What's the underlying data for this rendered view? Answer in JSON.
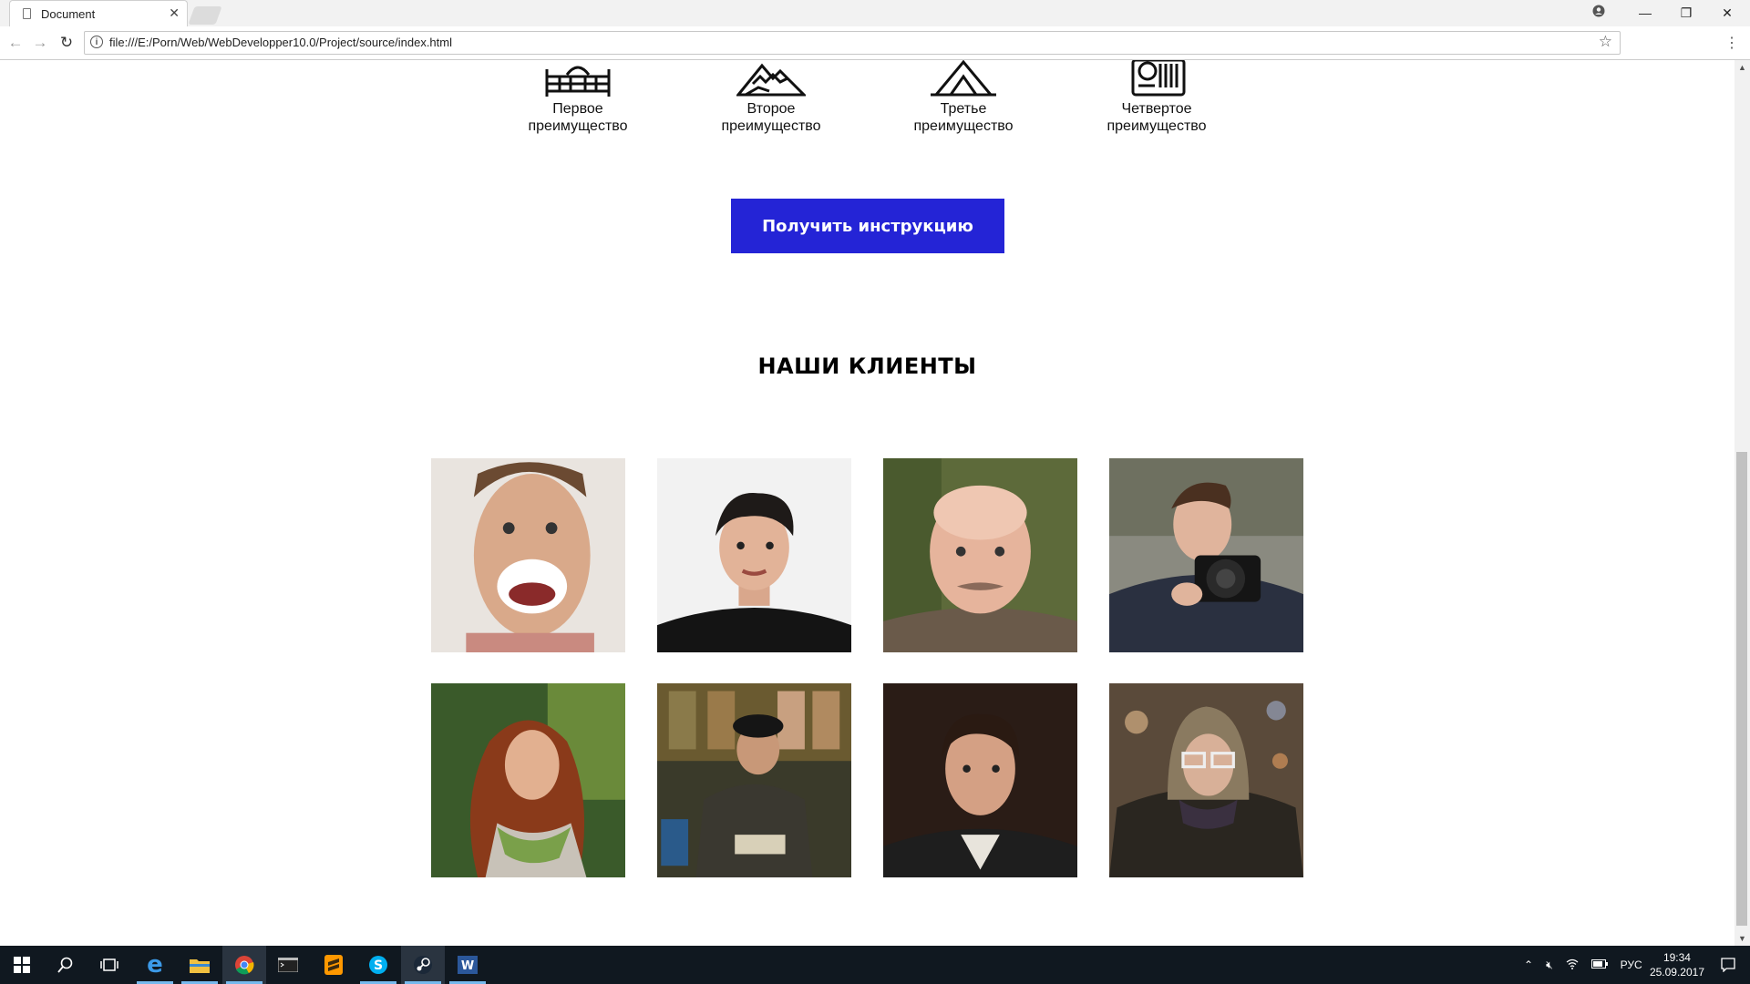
{
  "browser": {
    "tab_title": "Document",
    "tab_close": "✕",
    "url": "file:///E:/Porn/Web/WebDevelopper10.0/Project/source/index.html",
    "back": "←",
    "forward": "→",
    "reload": "↻",
    "star": "☆",
    "menu": "⋮",
    "window_controls": {
      "minimize": "—",
      "restore": "❐",
      "close": "✕"
    }
  },
  "advantages": [
    {
      "icon": "bed-icon",
      "line1": "Первое",
      "line2": "преимущество"
    },
    {
      "icon": "mountain-icon",
      "line1": "Второе",
      "line2": "преимущество"
    },
    {
      "icon": "tent-icon",
      "line1": "Третье",
      "line2": "преимущество"
    },
    {
      "icon": "passport-icon",
      "line1": "Четвертое",
      "line2": "преимущество"
    }
  ],
  "cta_label": "Получить инструкцию",
  "clients_heading": "НАШИ КЛИЕНТЫ",
  "clients": [
    {
      "name": "client-photo-1"
    },
    {
      "name": "client-photo-2"
    },
    {
      "name": "client-photo-3"
    },
    {
      "name": "client-photo-4"
    },
    {
      "name": "client-photo-5"
    },
    {
      "name": "client-photo-6"
    },
    {
      "name": "client-photo-7"
    },
    {
      "name": "client-photo-8"
    }
  ],
  "taskbar": {
    "language": "РУС",
    "time": "19:34",
    "date": "25.09.2017"
  },
  "colors": {
    "cta": "#2424d6",
    "taskbar": "#101820"
  }
}
